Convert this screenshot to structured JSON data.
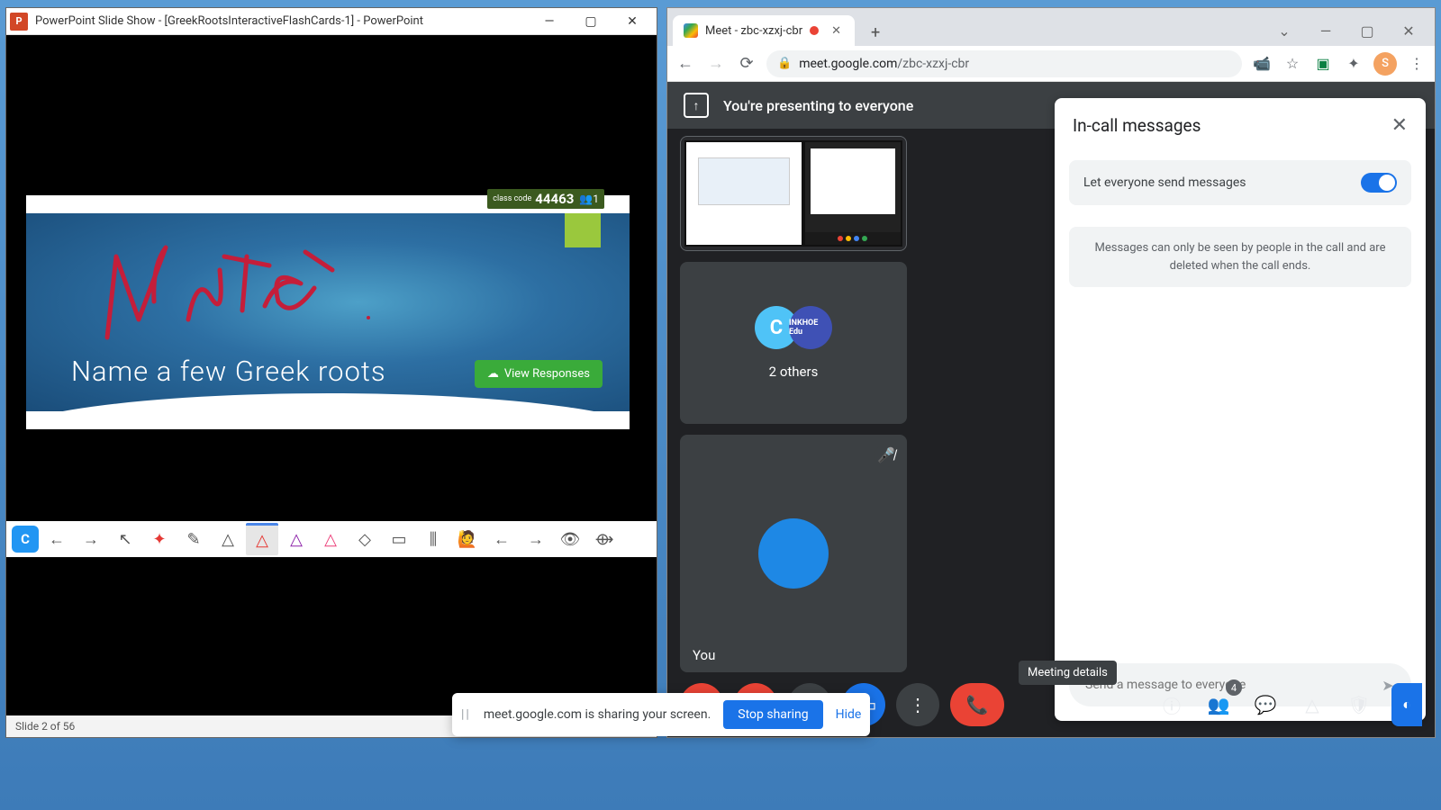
{
  "powerpoint": {
    "title": "PowerPoint Slide Show - [GreekRootsInteractiveFlashCards-1] - PowerPoint",
    "slide_question": "Name a few Greek roots",
    "view_responses": "View Responses",
    "class_code_label": "class\ncode",
    "class_code": "44463",
    "participants": "1",
    "status": "Slide 2 of 56",
    "ink_text": "Notes",
    "toolbar": {
      "app_letter": "C"
    }
  },
  "chrome": {
    "tab_title": "Meet - zbc-xzxj-cbr",
    "url_host": "meet.google.com",
    "url_path": "/zbc-xzxj-cbr",
    "avatar_letter": "S"
  },
  "meet": {
    "banner": "You're presenting to everyone",
    "others_label": "2 others",
    "you_label": "You",
    "others_av2_text": "INKHOE Edu",
    "people_badge": "4",
    "tooltip": "Meeting details"
  },
  "chat": {
    "title": "In-call messages",
    "toggle_label": "Let everyone send messages",
    "info": "Messages can only be seen by people in the call and are deleted when the call ends.",
    "placeholder": "Send a message to everyone"
  },
  "sharebar": {
    "text": "meet.google.com is sharing your screen.",
    "stop": "Stop sharing",
    "hide": "Hide"
  }
}
